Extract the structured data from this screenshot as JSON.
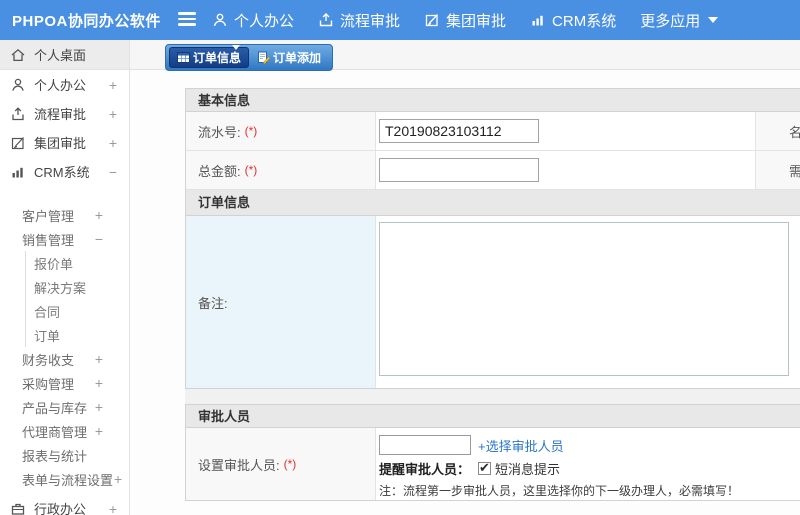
{
  "topbar": {
    "title": "PHPOA协同办公软件",
    "nav": [
      {
        "label": "个人办公",
        "icon": "user-icon"
      },
      {
        "label": "流程审批",
        "icon": "process-icon"
      },
      {
        "label": "集团审批",
        "icon": "edit-icon"
      },
      {
        "label": "CRM系统",
        "icon": "chart-icon"
      },
      {
        "label": "更多应用",
        "icon": "caret-down-icon"
      }
    ]
  },
  "sidebar": {
    "items": [
      {
        "label": "个人桌面",
        "icon": "home-icon",
        "expand": "",
        "level": 0,
        "selected": true
      },
      {
        "label": "个人办公",
        "icon": "user-icon",
        "expand": "+",
        "level": 0
      },
      {
        "label": "流程审批",
        "icon": "process-icon",
        "expand": "+",
        "level": 0
      },
      {
        "label": "集团审批",
        "icon": "edit-icon",
        "expand": "+",
        "level": 0
      },
      {
        "label": "CRM系统",
        "icon": "chart-icon",
        "expand": "−",
        "level": 0
      },
      {
        "label": "客户管理",
        "expand": "+",
        "level": 1
      },
      {
        "label": "销售管理",
        "expand": "−",
        "level": 1
      },
      {
        "label": "报价单",
        "expand": "",
        "level": 2
      },
      {
        "label": "解决方案",
        "expand": "",
        "level": 2
      },
      {
        "label": "合同",
        "expand": "",
        "level": 2
      },
      {
        "label": "订单",
        "expand": "",
        "level": 2
      },
      {
        "label": "财务收支",
        "expand": "+",
        "level": 1
      },
      {
        "label": "采购管理",
        "expand": "+",
        "level": 1
      },
      {
        "label": "产品与库存",
        "expand": "+",
        "level": 1
      },
      {
        "label": "代理商管理",
        "expand": "+",
        "level": 1
      },
      {
        "label": "报表与统计",
        "expand": "",
        "level": 1
      },
      {
        "label": "表单与流程设置",
        "expand": "+",
        "level": 1
      },
      {
        "label": "行政办公",
        "icon": "briefcase-icon",
        "expand": "+",
        "level": 0
      }
    ]
  },
  "tabs": [
    {
      "label": "订单信息",
      "active": true
    },
    {
      "label": "订单添加",
      "active": false
    }
  ],
  "form": {
    "sections": {
      "basic": "基本信息",
      "order": "订单信息",
      "approver": "审批人员"
    },
    "rows": {
      "serial": {
        "label": "流水号:",
        "required": "(*)",
        "value": "T20190823103112"
      },
      "amount": {
        "label": "总金额:",
        "required": "(*)",
        "value": ""
      },
      "remark": {
        "label": "备注:",
        "value": ""
      }
    },
    "col2": {
      "row1": "名",
      "row2": "需"
    },
    "approver": {
      "label": "设置审批人员:",
      "required": "(*)",
      "input_value": "",
      "choose_link": "+选择审批人员",
      "remind_label": "提醒审批人员：",
      "sms_label": "短消息提示",
      "sms_checked": true,
      "note": "注：流程第一步审批人员，这里选择你的下一级办理人，必需填写！"
    }
  },
  "colors": {
    "topbar_blue": "#4a90e2",
    "tab_active_navy": "#123e86",
    "link_blue": "#2b77c8",
    "required_red": "#e03131",
    "remark_cell_blue": "#e9f4fb",
    "section_header_gray": "#e8e8e8"
  }
}
